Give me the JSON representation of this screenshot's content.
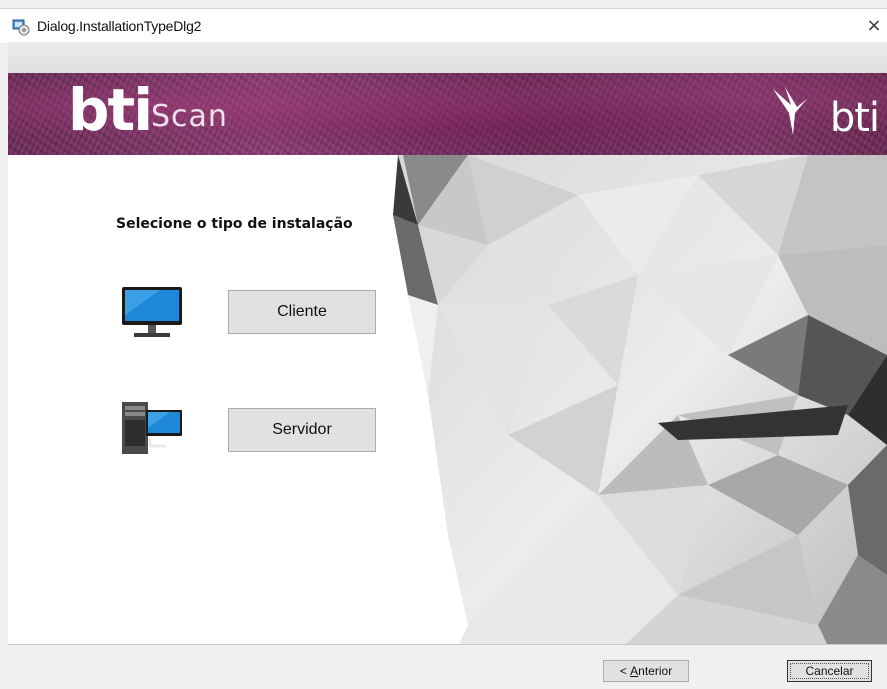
{
  "window": {
    "title": "Dialog.InstallationTypeDlg2",
    "close_glyph": "×"
  },
  "banner": {
    "logo_main": "bti",
    "logo_sub": "Scan",
    "brand": "bti"
  },
  "main": {
    "heading": "Selecione o tipo de instalação",
    "options": [
      {
        "label": "Cliente",
        "icon": "monitor-icon"
      },
      {
        "label": "Servidor",
        "icon": "server-icon"
      }
    ]
  },
  "footer": {
    "back_prefix": "< ",
    "back_accel": "A",
    "back_rest": "nterior",
    "cancel_label": "Cancelar"
  },
  "colors": {
    "banner_purple": "#7a2f63",
    "button_face": "#e1e1e1"
  }
}
